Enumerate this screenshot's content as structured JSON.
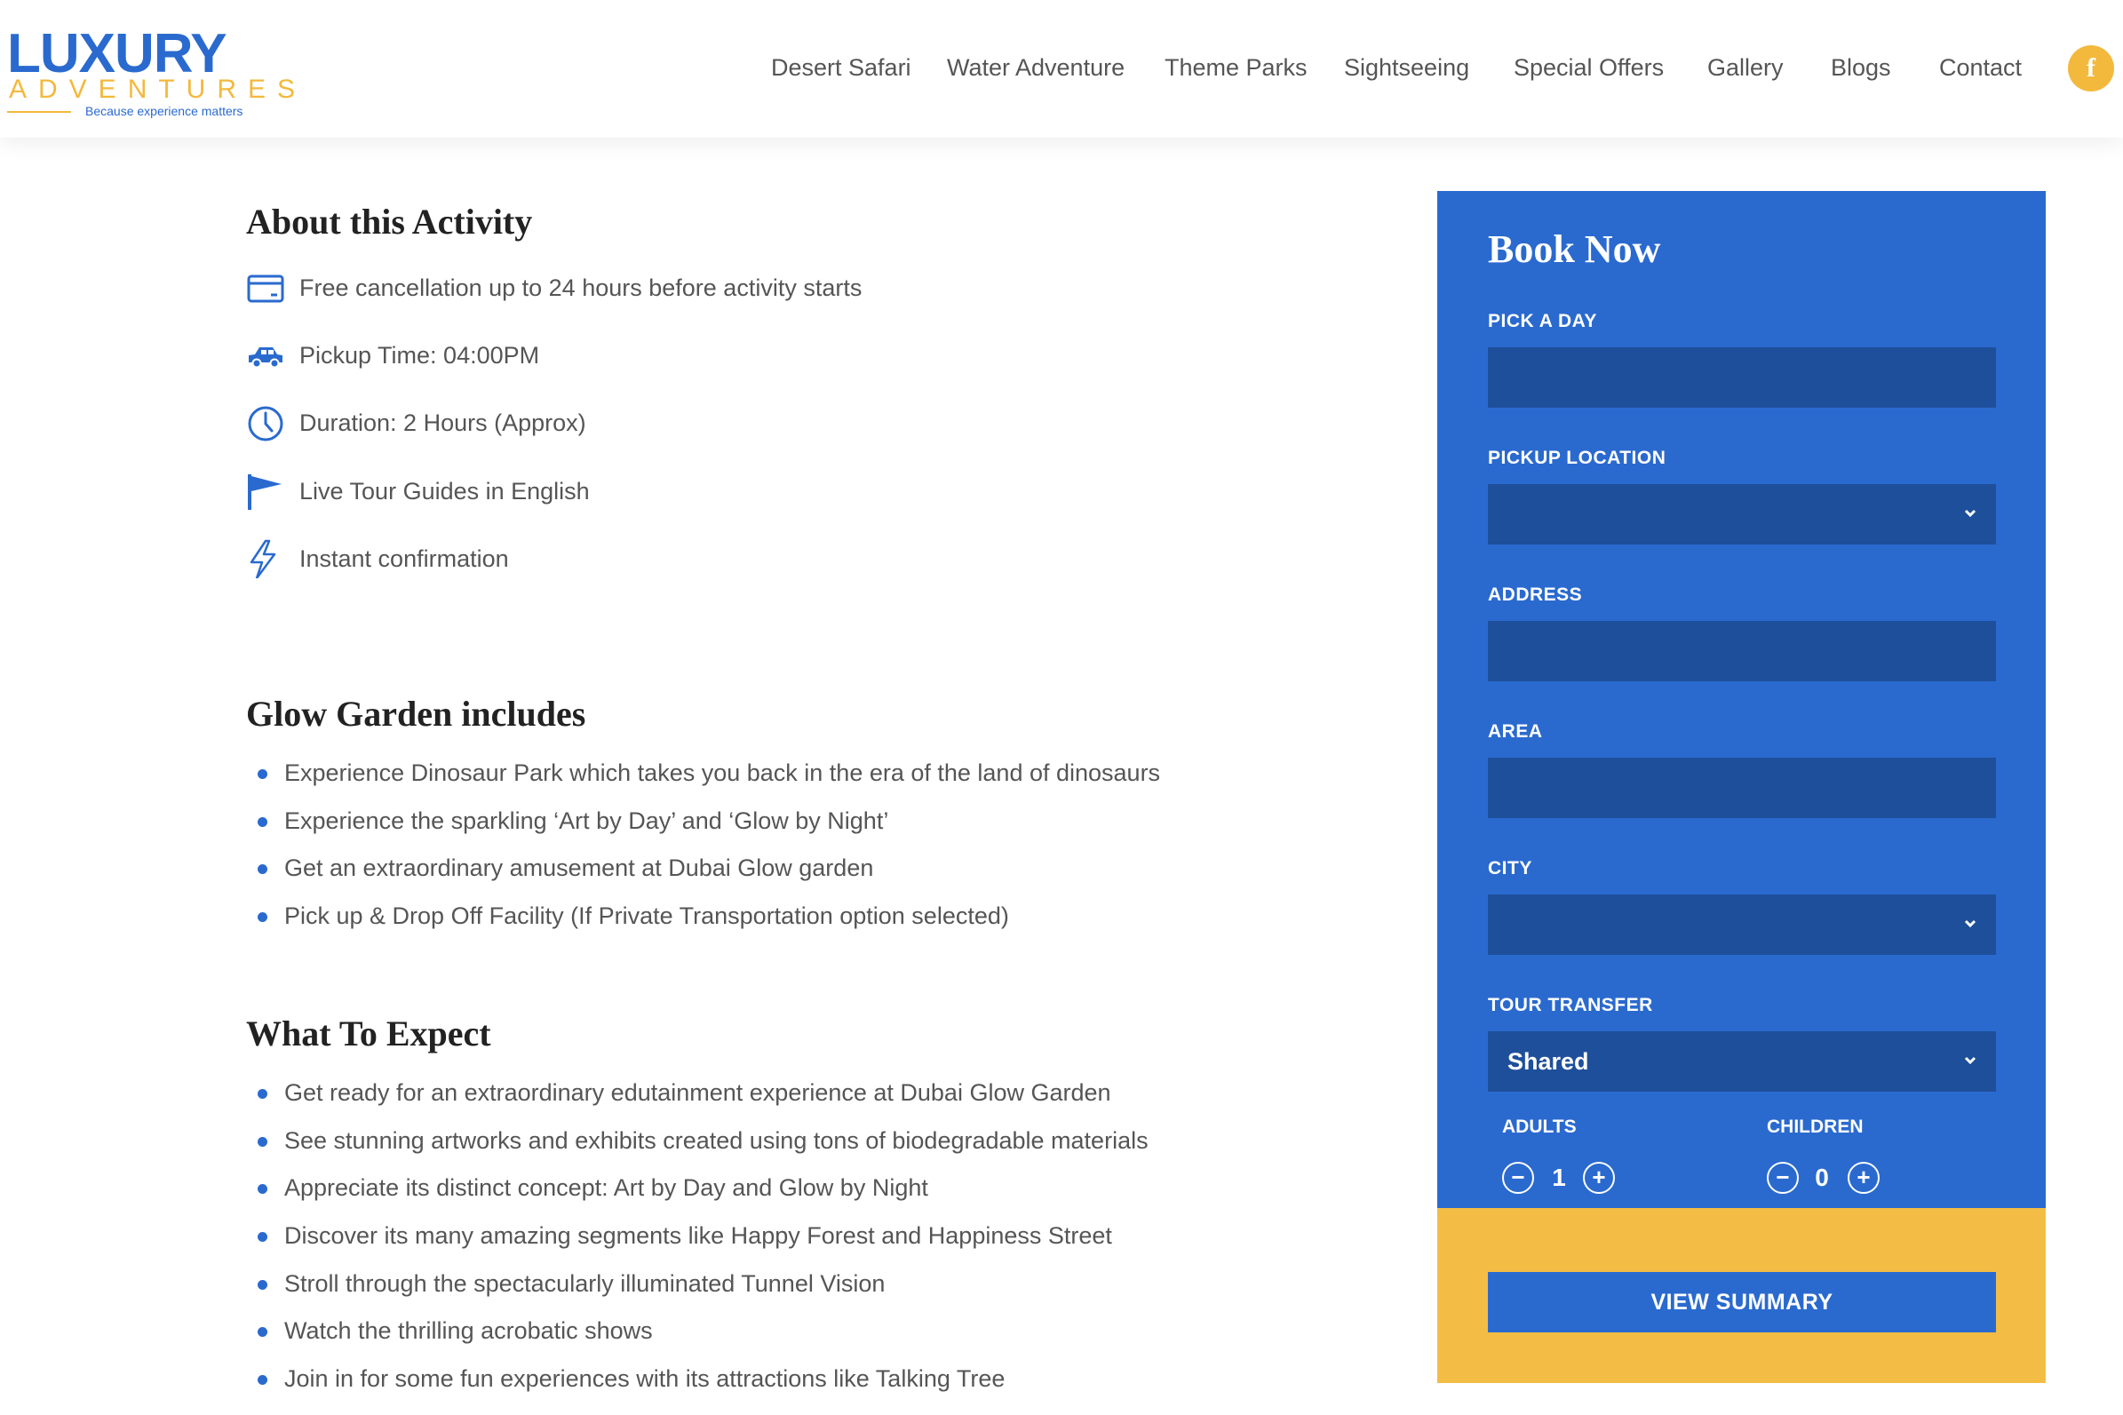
{
  "logo": {
    "main": "LUXURY",
    "sub": "ADVENTURES",
    "tagline": "Because experience matters"
  },
  "nav": {
    "items": [
      "Desert Safari",
      "Water Adventure",
      "Theme Parks",
      "Sightseeing",
      "Special Offers",
      "Gallery",
      "Blogs",
      "Contact"
    ],
    "facebook": "f"
  },
  "about": {
    "title": "About this Activity",
    "features": [
      {
        "icon": "card-icon",
        "text": "Free cancellation up to 24 hours before activity starts"
      },
      {
        "icon": "car-icon",
        "text": "Pickup Time: 04:00PM"
      },
      {
        "icon": "clock-icon",
        "text": "Duration: 2 Hours (Approx)"
      },
      {
        "icon": "flag-icon",
        "text": "Live Tour Guides in English"
      },
      {
        "icon": "lightning-icon",
        "text": "Instant confirmation"
      }
    ]
  },
  "includes": {
    "title": "Glow Garden includes",
    "items": [
      "Experience Dinosaur Park which takes you back in the era of the land of dinosaurs",
      "Experience the sparkling ‘Art by Day’ and ‘Glow by Night’",
      "Get an extraordinary amusement at Dubai Glow garden",
      "Pick up & Drop Off Facility (If Private Transportation option selected)"
    ]
  },
  "expect": {
    "title": "What To Expect",
    "items": [
      "Get ready for an extraordinary edutainment experience at Dubai Glow Garden",
      "See stunning artworks and exhibits created using tons of biodegradable materials",
      "Appreciate its distinct concept: Art by Day and Glow by Night",
      "Discover its many amazing segments like Happy Forest and Happiness Street",
      "Stroll through the spectacularly illuminated Tunnel Vision",
      "Watch the thrilling acrobatic shows",
      "Join in for some fun experiences with its attractions like Talking Tree"
    ]
  },
  "booking": {
    "title": "Book Now",
    "fields": [
      {
        "label": "PICK A DAY",
        "value": "",
        "type": "input"
      },
      {
        "label": "PICKUP LOCATION",
        "value": "",
        "type": "select"
      },
      {
        "label": "ADDRESS",
        "value": "",
        "type": "input"
      },
      {
        "label": "AREA",
        "value": "",
        "type": "input"
      },
      {
        "label": "CITY",
        "value": "",
        "type": "select"
      },
      {
        "label": "TOUR TRANSFER",
        "value": "Shared",
        "type": "select"
      }
    ],
    "adults": {
      "label": "ADULTS",
      "value": "1",
      "minus": "−",
      "plus": "+"
    },
    "children": {
      "label": "CHILDREN",
      "value": "0",
      "minus": "−",
      "plus": "+"
    },
    "submit": "VIEW SUMMARY"
  },
  "colors": {
    "primary": "#2a6acf",
    "field": "#1e4f9a",
    "accent": "#f3bd45"
  }
}
